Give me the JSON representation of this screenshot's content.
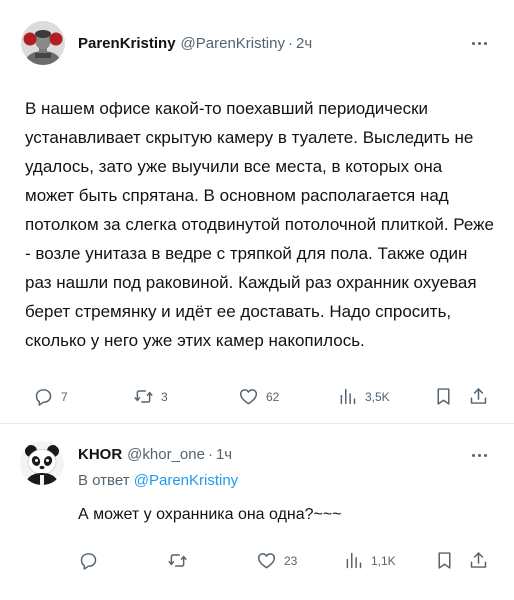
{
  "main_tweet": {
    "display_name": "ParenKristiny",
    "handle": "@ParenKristiny",
    "separator": "·",
    "time": "2ч",
    "text": "В нашем офисе какой-то поехавший периодически устанавливает скрытую камеру в туалете. Выследить не удалось, зато уже выучили все места, в которых она может быть спрятана. В основном располагается над потолком за слегка отодвинутой потолочной плиткой. Реже - возле унитаза в ведре с тряпкой для пола. Также один раз нашли под раковиной. Каждый раз охранник охуевая берет стремянку и идёт ее доставать. Надо спросить, сколько у него уже этих камер накопилось.",
    "replies": "7",
    "retweets": "3",
    "likes": "62",
    "views": "3,5K",
    "icons": [
      "reply-icon",
      "retweet-icon",
      "like-icon",
      "views-icon",
      "bookmark-icon",
      "share-icon",
      "more-icon"
    ]
  },
  "reply_tweet": {
    "display_name": "KHOR",
    "handle": "@khor_one",
    "separator": "·",
    "time": "1ч",
    "reply_prefix": "В ответ",
    "reply_mention": "@ParenKristiny",
    "text": "А может у охранника она одна?~~~",
    "likes": "23",
    "views": "1,1K"
  },
  "colors": {
    "text": "#0f1419",
    "secondary": "#536471",
    "accent": "#1d9bf0",
    "divider": "#e7e9ea"
  }
}
